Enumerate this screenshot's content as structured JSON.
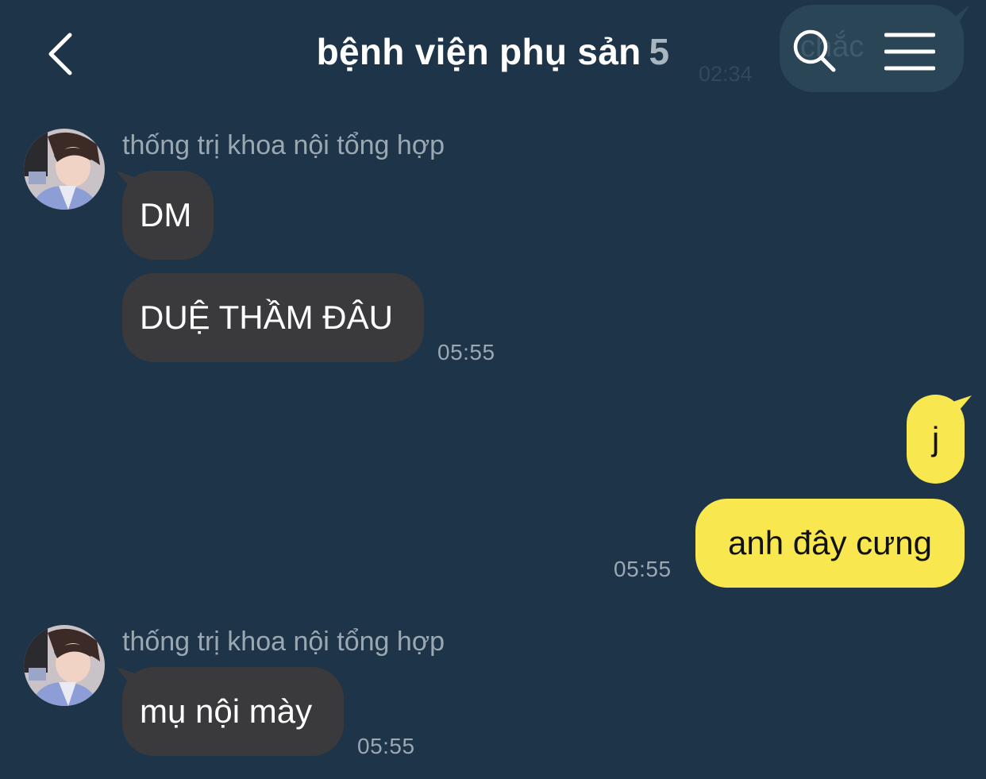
{
  "header": {
    "title": "bệnh viện phụ sản",
    "member_count": "5"
  },
  "ghost": {
    "text": "chắc",
    "time": "02:34"
  },
  "messages": [
    {
      "sender": "thống trị khoa nội tổng hợp",
      "bubbles": [
        "DM",
        "DUỆ THẦM ĐÂU"
      ],
      "time": "05:55"
    },
    {
      "bubbles": [
        "j",
        "anh đây cưng"
      ],
      "time": "05:55"
    },
    {
      "sender": "thống trị khoa nội tổng hợp",
      "bubbles": [
        "mụ nội mày"
      ],
      "time": "05:55"
    }
  ],
  "colors": {
    "background": "#1e3448",
    "incoming_bubble": "#3a3a3c",
    "outgoing_bubble": "#f8e74e",
    "muted_text": "#9aa8b2"
  },
  "icons": {
    "back": "chevron-left-icon",
    "search": "search-icon",
    "menu": "menu-icon"
  }
}
